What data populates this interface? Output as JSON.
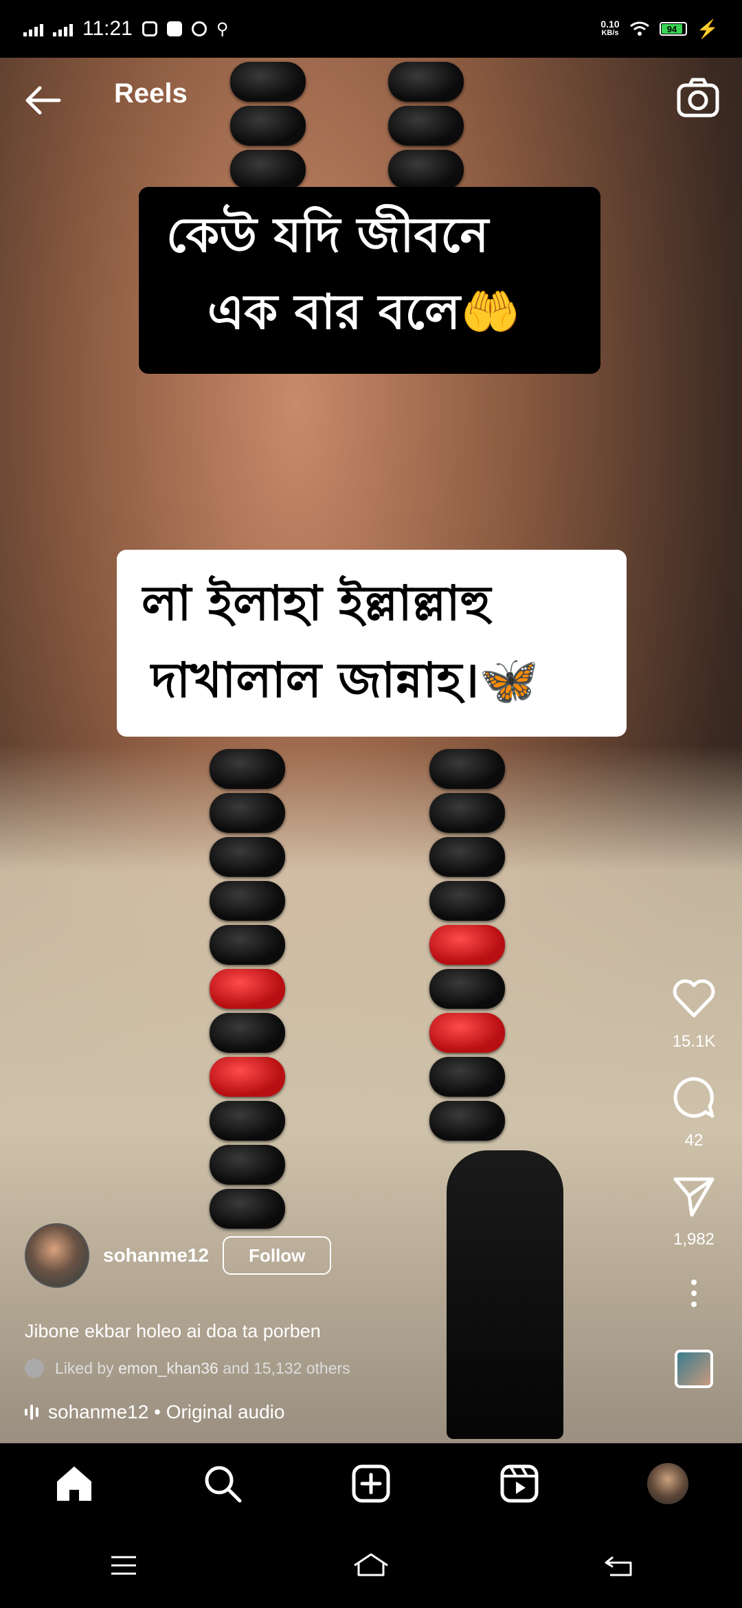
{
  "status_bar": {
    "time": "11:21",
    "net_speed_value": "0.10",
    "net_speed_unit": "KB/s",
    "battery": "94"
  },
  "header": {
    "title": "Reels",
    "back_icon": "arrow-left-icon",
    "camera_icon": "camera-icon"
  },
  "video": {
    "caption_top_line1": "কেউ যদি জীবনে",
    "caption_top_line2": "এক বার বলে🤲",
    "caption_bottom_line1": "লা ইলাহা ইল্লাল্লাহু",
    "caption_bottom_line2": "দাখালাল জান্নাহ।🦋"
  },
  "actions": {
    "likes": "15.1K",
    "comments": "42",
    "shares": "1,982"
  },
  "post": {
    "username": "sohanme12",
    "follow_label": "Follow",
    "caption": "Jibone ekbar holeo ai doa ta porben",
    "liked_prefix": "Liked by",
    "liked_user": "emon_khan36",
    "liked_suffix": "and 15,132 others",
    "audio": "sohanme12 • Original audio"
  },
  "bottom_nav": [
    "home",
    "search",
    "create",
    "reels",
    "profile"
  ],
  "system_nav": [
    "menu",
    "home",
    "back"
  ]
}
